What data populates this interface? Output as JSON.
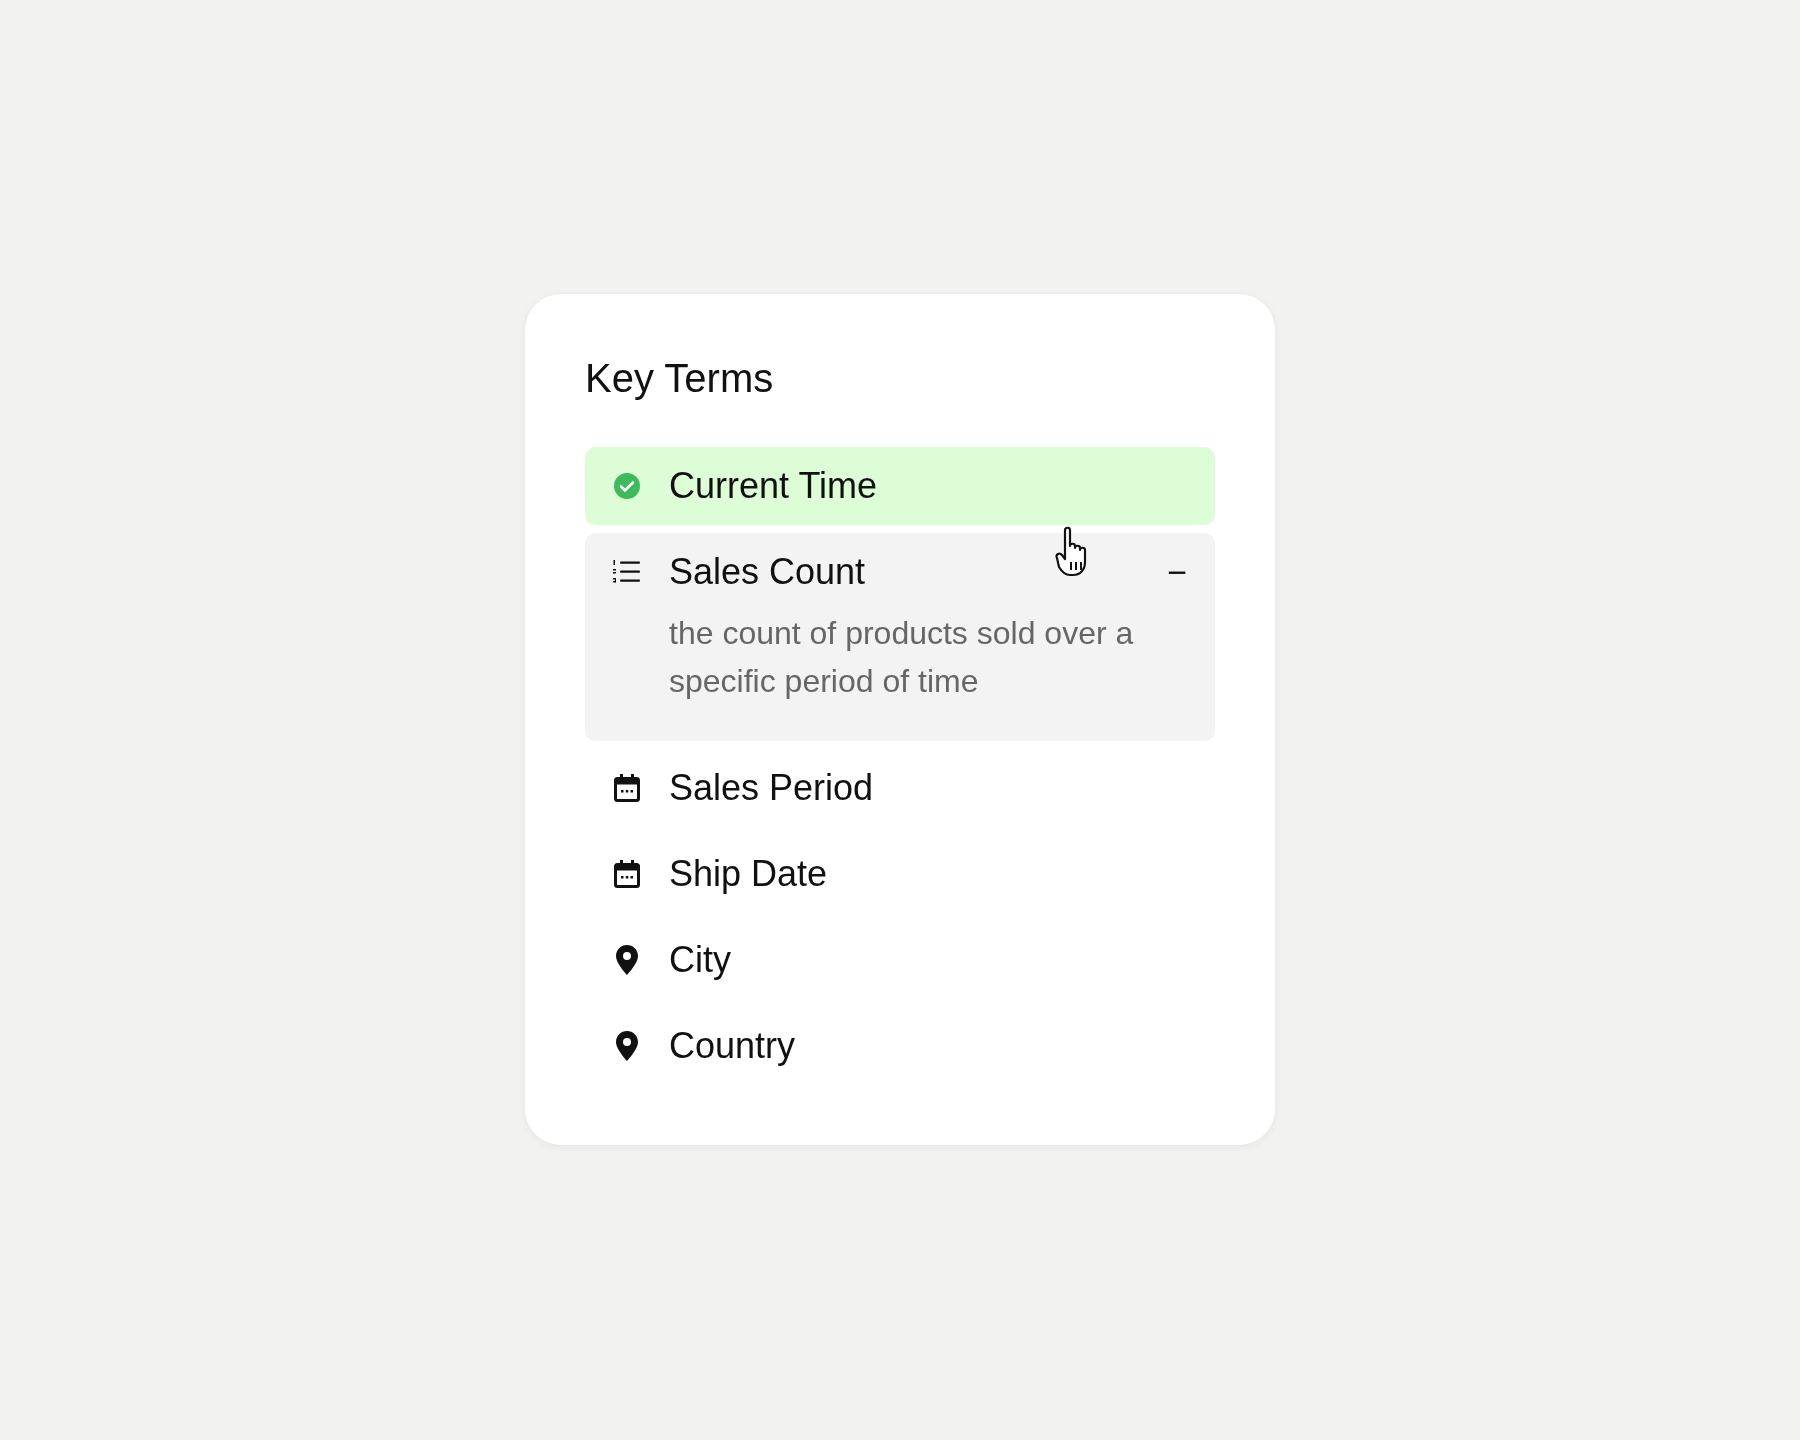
{
  "title": "Key Terms",
  "items": [
    {
      "label": "Current Time",
      "kind": "check",
      "selected": true,
      "expanded": false
    },
    {
      "label": "Sales Count",
      "kind": "list",
      "selected": false,
      "expanded": true,
      "description": "the count of products sold over a specific period of time",
      "toggle": "−"
    },
    {
      "label": "Sales Period",
      "kind": "calendar",
      "selected": false,
      "expanded": false
    },
    {
      "label": "Ship Date",
      "kind": "calendar",
      "selected": false,
      "expanded": false
    },
    {
      "label": "City",
      "kind": "pin",
      "selected": false,
      "expanded": false
    },
    {
      "label": "Country",
      "kind": "pin",
      "selected": false,
      "expanded": false
    }
  ]
}
